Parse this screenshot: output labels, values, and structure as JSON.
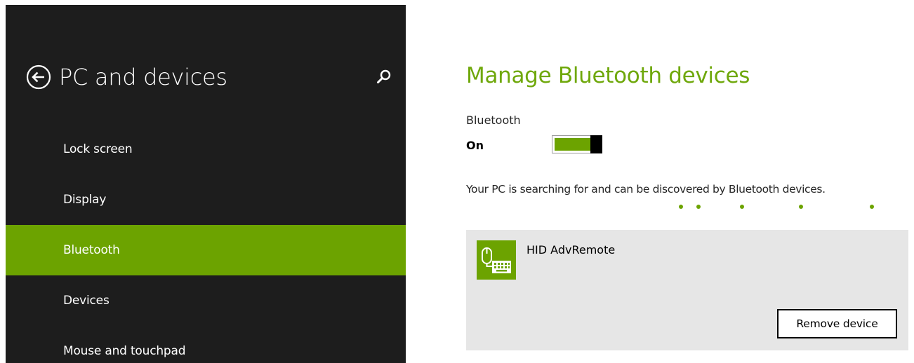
{
  "left_pane": {
    "title": "PC and devices",
    "back_icon": "back-arrow-icon",
    "search_icon": "search-icon",
    "nav_items": [
      {
        "label": "Lock screen",
        "selected": false
      },
      {
        "label": "Display",
        "selected": false
      },
      {
        "label": "Bluetooth",
        "selected": true
      },
      {
        "label": "Devices",
        "selected": false
      },
      {
        "label": "Mouse and touchpad",
        "selected": false
      }
    ]
  },
  "main": {
    "title": "Manage Bluetooth devices",
    "bluetooth_toggle": {
      "caption": "Bluetooth",
      "state_label": "On",
      "is_on": true
    },
    "status_text": "Your PC is searching for and can be discovered by Bluetooth devices.",
    "device": {
      "name": "HID AdvRemote",
      "icon": "keyboard-mouse-icon",
      "remove_label": "Remove device"
    }
  },
  "colors": {
    "accent": "#6ca300",
    "title_green": "#6fa80b",
    "left_pane_bg": "#1d1d1d",
    "tile_bg": "#e6e6e6"
  }
}
